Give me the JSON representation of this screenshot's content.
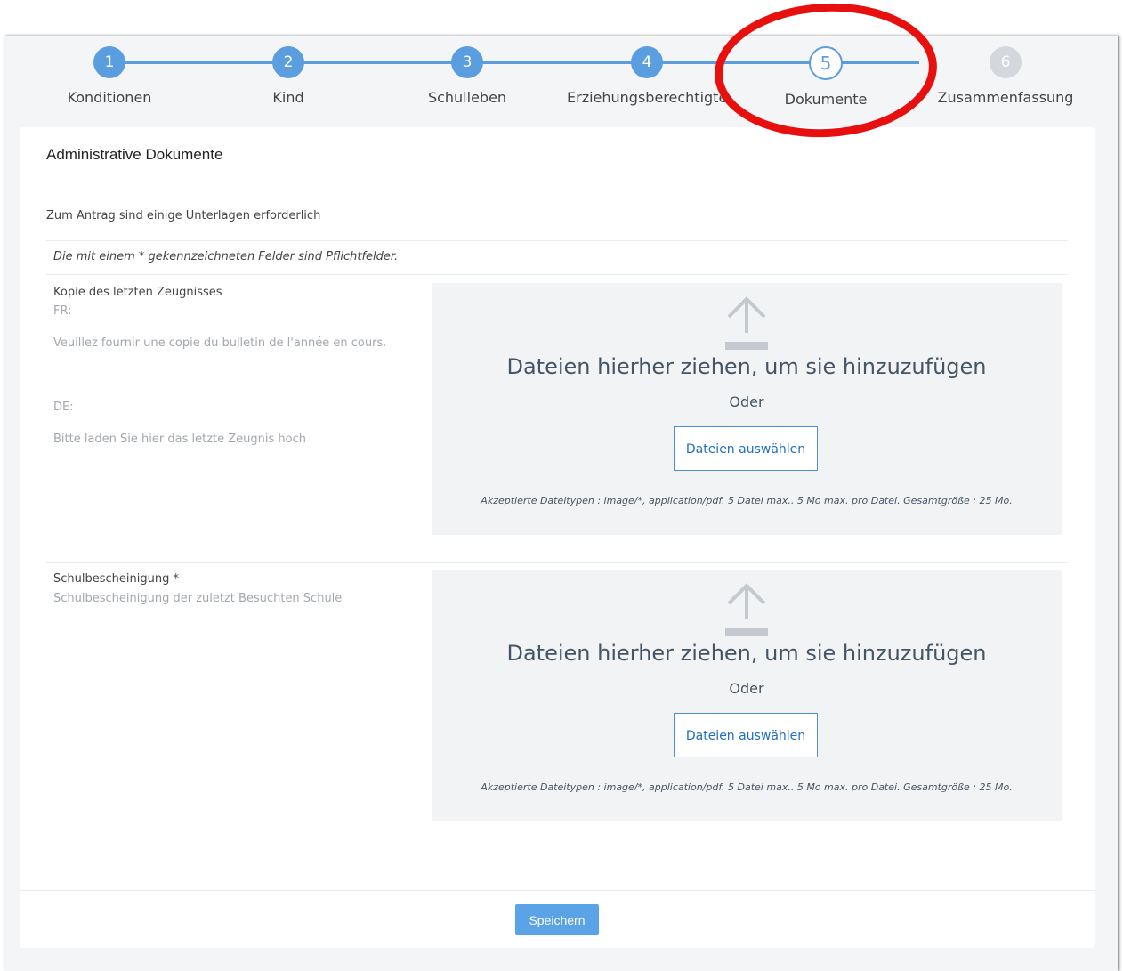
{
  "stepper": {
    "steps": [
      {
        "number": "1",
        "label": "Konditionen"
      },
      {
        "number": "2",
        "label": "Kind"
      },
      {
        "number": "3",
        "label": "Schulleben"
      },
      {
        "number": "4",
        "label": "Erziehungsberechtigte"
      },
      {
        "number": "5",
        "label": "Dokumente"
      },
      {
        "number": "6",
        "label": "Zusammenfassung"
      }
    ],
    "active_step": 5
  },
  "colors": {
    "accent": "#5b9ee0",
    "annotation": "#e8100f",
    "pending": "#d4d8dc"
  },
  "card": {
    "title": "Administrative Dokumente",
    "intro": "Zum Antrag sind einige Unterlagen erforderlich",
    "required_hint": "Die mit einem * gekennzeichneten Felder sind Pflichtfelder."
  },
  "fields": [
    {
      "label": "Kopie des letzten Zeugnisses",
      "fr_label": "FR:",
      "fr_text": "Veuillez fournir une copie du bulletin de l'année en cours.",
      "de_label": "DE:",
      "de_text": "Bitte laden Sie hier das letzte Zeugnis hoch"
    },
    {
      "label": "Schulbescheinigung *",
      "description": "Schulbescheinigung der zuletzt Besuchten Schule"
    }
  ],
  "dropzone": {
    "title": "Dateien hierher ziehen, um sie hinzuzufügen",
    "or": "Oder",
    "button": "Dateien auswählen",
    "note": "Akzeptierte Dateitypen : image/*, application/pdf. 5 Datei max.. 5 Mo max. pro Datei. Gesamtgröße : 25 Mo.",
    "icon": "upload-arrow-icon"
  },
  "footer": {
    "save_label": "Speichern"
  }
}
